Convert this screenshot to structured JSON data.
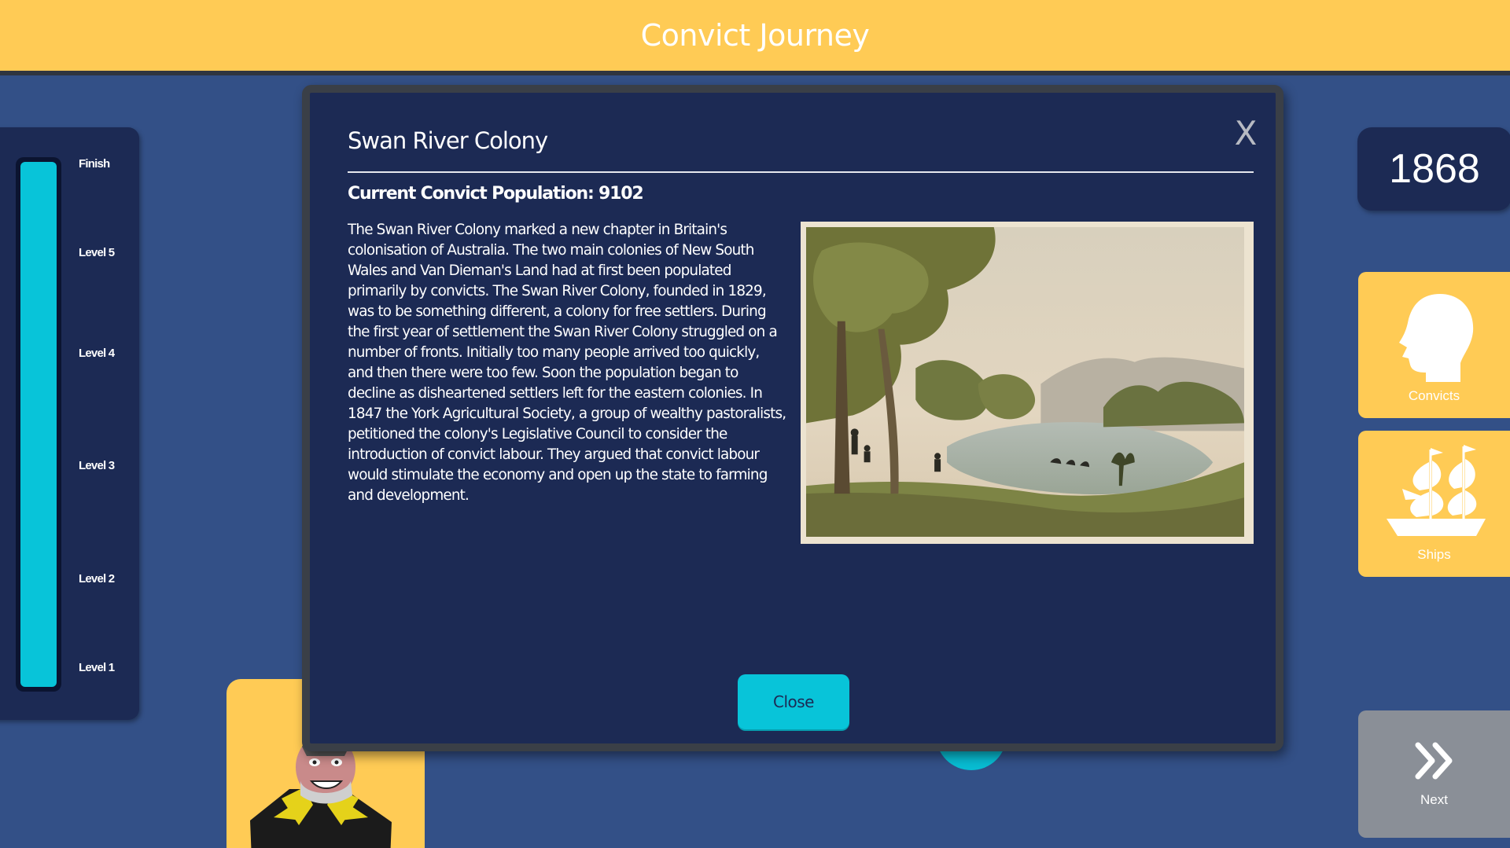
{
  "app": {
    "title": "Convict Journey"
  },
  "levels": {
    "labels": [
      "Finish",
      "Level 5",
      "Level 4",
      "Level 3",
      "Level 2",
      "Level 1"
    ],
    "progress": 1.0
  },
  "year": "1868",
  "side_panel": {
    "convicts_label": "Convicts",
    "ships_label": "Ships",
    "next_label": "Next"
  },
  "modal": {
    "title": "Swan River Colony",
    "close_x": "X",
    "population": "Current Convict Population: 9102",
    "body": "The Swan River Colony marked a new chapter in Britain's colonisation of Australia. The two main colonies of New South Wales and Van Dieman's Land had at first been populated primarily by convicts. The Swan River Colony, founded in 1829, was to be something different, a colony for free settlers. During the first year of settlement the Swan River Colony struggled on a number of fronts. Initially too many people arrived too quickly, and then there were too few. Soon the population began to decline as disheartened settlers left for the eastern colonies. In 1847 the York Agricultural Society, a group of wealthy pastoralists, petitioned the colony's Legislative Council to consider the introduction of convict labour. They argued that convict labour would stimulate the economy and open up the state to farming and development.",
    "close_button": "Close"
  },
  "colors": {
    "background": "#335087",
    "topbar": "#ffcb55",
    "panel": "#1c2a54",
    "accent": "#08c4d9",
    "next_card": "#8a8f97"
  },
  "icons": {
    "convicts": "head-silhouette-icon",
    "ships": "sailing-ship-icon",
    "next": "double-chevron-right-icon",
    "close": "close-icon"
  }
}
